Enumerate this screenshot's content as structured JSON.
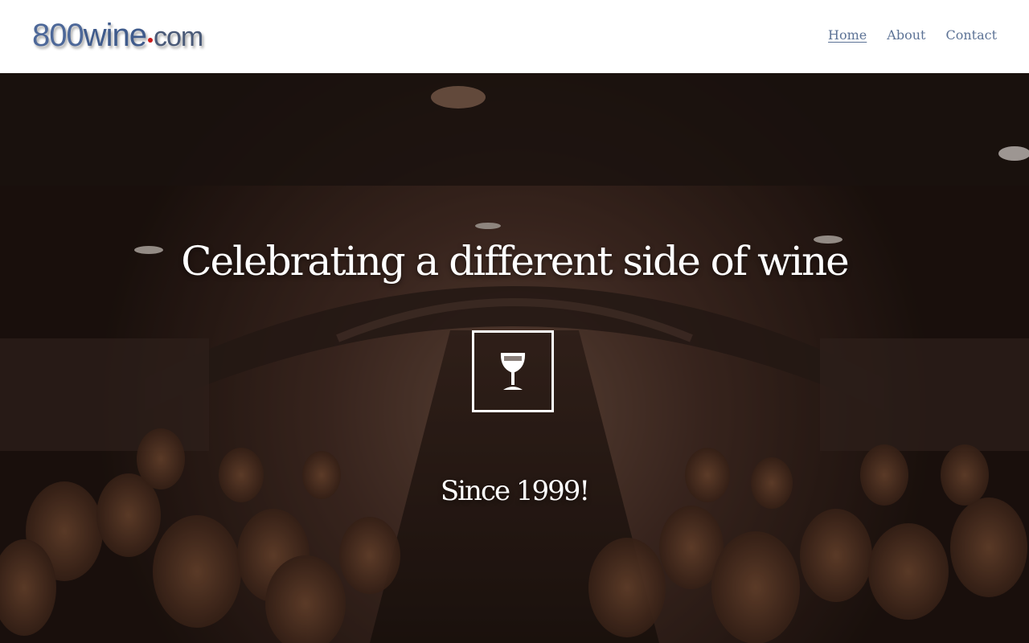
{
  "header": {
    "logo": {
      "part1": "800",
      "part2": "wine",
      "part3": "com"
    },
    "nav": [
      {
        "label": "Home",
        "active": true
      },
      {
        "label": "About",
        "active": false
      },
      {
        "label": "Contact",
        "active": false
      }
    ]
  },
  "hero": {
    "headline": "Celebrating a different side of wine",
    "icon": "wine-glass-icon",
    "tagline": "Since 1999!"
  },
  "colors": {
    "nav_link": "#5d7396",
    "logo_blue": "#3f5b8c",
    "logo_dot": "#c81b1b",
    "hero_overlay": "#1f1410",
    "hero_text": "#ffffff"
  }
}
